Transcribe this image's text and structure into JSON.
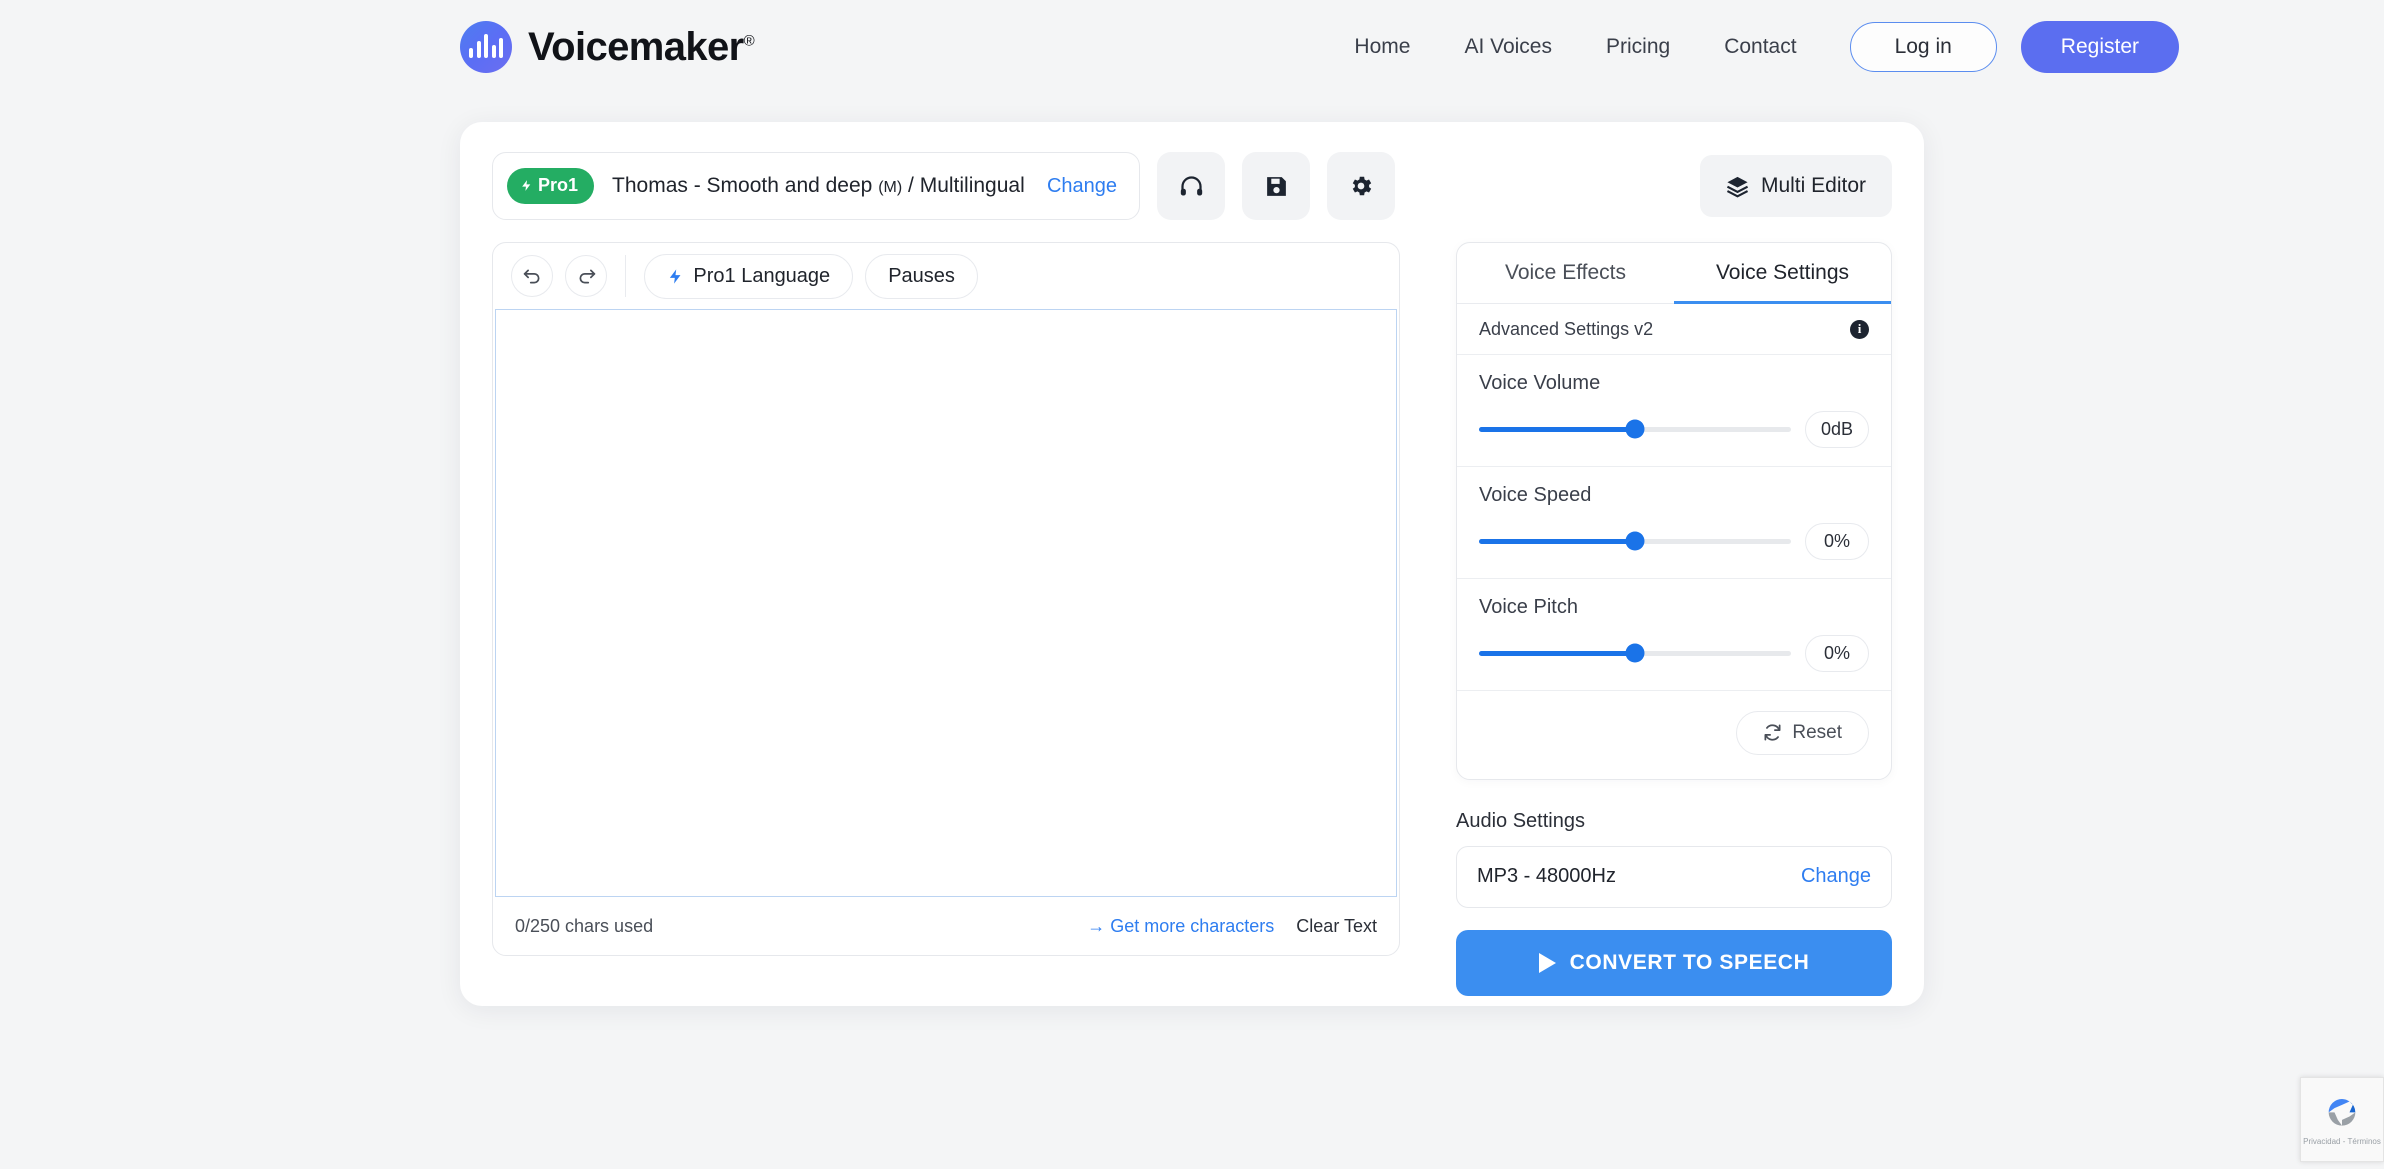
{
  "header": {
    "brand": {
      "name": "Voicemaker",
      "registered": "®",
      "logo_icon": "waveform-logo-icon"
    },
    "nav": [
      {
        "label": "Home",
        "name": "nav-home"
      },
      {
        "label": "AI Voices",
        "name": "nav-ai-voices"
      },
      {
        "label": "Pricing",
        "name": "nav-pricing"
      },
      {
        "label": "Contact",
        "name": "nav-contact"
      }
    ],
    "login_label": "Log in",
    "register_label": "Register"
  },
  "voice_bar": {
    "badge": "Pro1",
    "badge_icon": "lightning-bolt-icon",
    "voice_name": "Thomas - Smooth and deep",
    "voice_gender": "(M)",
    "voice_language": "/ Multilingual",
    "change_label": "Change",
    "actions": [
      {
        "name": "headphones-icon",
        "title": "Preview"
      },
      {
        "name": "save-icon",
        "title": "Save"
      },
      {
        "name": "gear-icon",
        "title": "Settings"
      }
    ],
    "multi_editor_label": "Multi Editor",
    "multi_editor_icon": "layers-icon"
  },
  "editor": {
    "undo_icon": "undo-icon",
    "redo_icon": "redo-icon",
    "pro_language_label": "Pro1 Language",
    "pro_language_icon": "lightning-bolt-icon",
    "pauses_label": "Pauses",
    "text_value": "",
    "chars_used": "0/250 chars used",
    "get_more_label": "Get more characters",
    "get_more_arrow": "→",
    "clear_text_label": "Clear Text"
  },
  "settings": {
    "tabs": [
      {
        "label": "Voice Effects",
        "active": false
      },
      {
        "label": "Voice Settings",
        "active": true
      }
    ],
    "advanced_label": "Advanced Settings v2",
    "info_icon": "info-icon",
    "sliders": [
      {
        "label": "Voice Volume",
        "value": "0dB",
        "position": 50
      },
      {
        "label": "Voice Speed",
        "value": "0%",
        "position": 50
      },
      {
        "label": "Voice Pitch",
        "value": "0%",
        "position": 50
      }
    ],
    "reset_label": "Reset",
    "reset_icon": "refresh-icon"
  },
  "audio": {
    "title": "Audio Settings",
    "format": "MP3 - 48000Hz",
    "change_label": "Change"
  },
  "convert": {
    "label": "CONVERT TO SPEECH",
    "icon": "play-icon"
  },
  "recaptcha": {
    "icon": "recaptcha-icon",
    "privacy": "Privacidad",
    "separator": "-",
    "terms": "Términos"
  },
  "colors": {
    "page_bg": "#f4f5f6",
    "accent_blue": "#3b8ef0",
    "register_blue": "#5b6ef0",
    "pro_green": "#24ad63",
    "slider_blue": "#1a73e8",
    "link_blue": "#2e7df0"
  }
}
